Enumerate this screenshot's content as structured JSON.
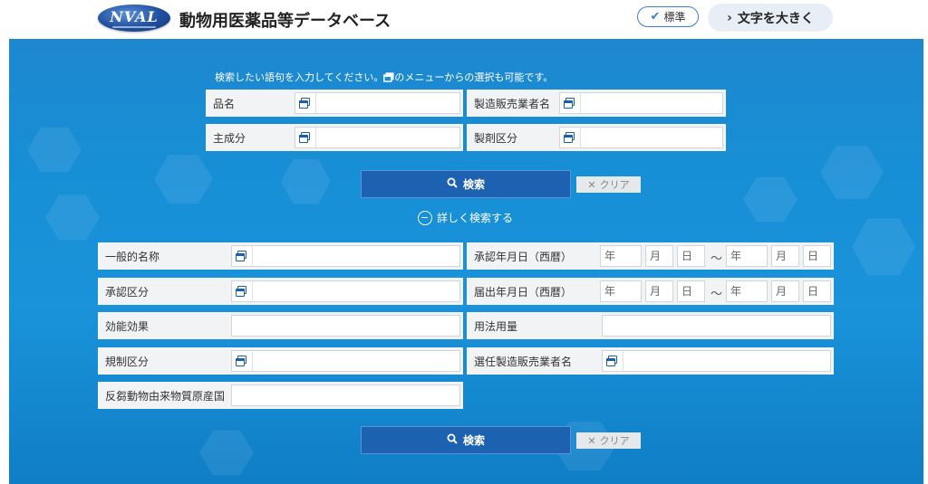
{
  "header": {
    "logo_text": "NVAL",
    "title": "動物用医薬品等データベース",
    "std_button": "標準",
    "std_icon": "check-icon",
    "large_button": "文字を大きく",
    "large_icon": "chevron-right-icon"
  },
  "hint": {
    "before": "検索したい語句を入力してください。",
    "after": "のメニューからの選択も可能です。"
  },
  "basic": {
    "product_name": "品名",
    "manufacturer": "製造販売業者名",
    "ingredient": "主成分",
    "dosage_form": "製剤区分"
  },
  "search_label": "検索",
  "clear_label": "クリア",
  "toggle_label": "詳しく検索する",
  "detail": {
    "generic_name": "一般的名称",
    "approval_date": "承認年月日（西暦）",
    "approval_category": "承認区分",
    "notification_date": "届出年月日（西暦）",
    "efficacy": "効能効果",
    "dosage": "用法用量",
    "regulatory_category": "規制区分",
    "selected_manufacturer": "選任製造販売業者名",
    "ruminant_origin": "反芻動物由来物質原産国"
  },
  "date_placeholders": {
    "year": "年",
    "month": "月",
    "day": "日",
    "range": "～"
  },
  "colors": {
    "header_bg": "#ffffff",
    "main_bg": "#1a8fd6",
    "search_btn": "#1d61b1",
    "accent": "#3b7fd3"
  }
}
